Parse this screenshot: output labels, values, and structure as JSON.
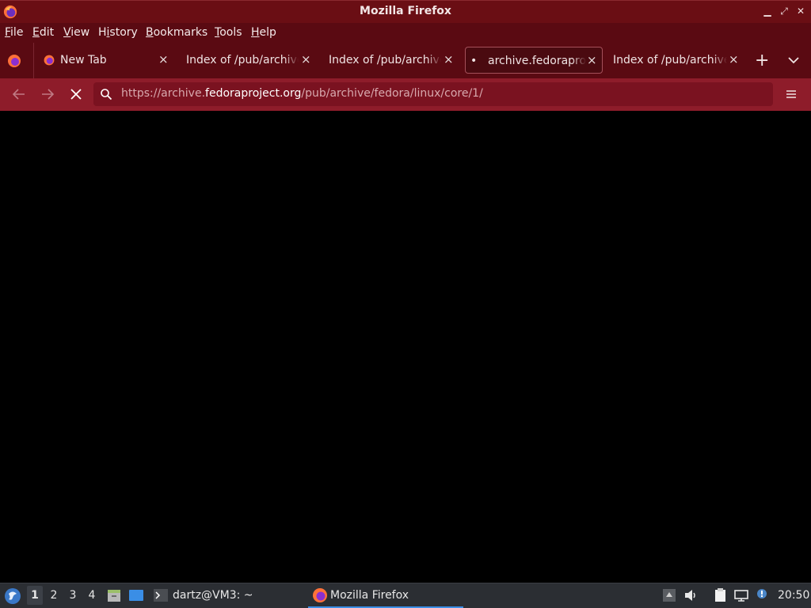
{
  "window": {
    "title": "Mozilla Firefox"
  },
  "menubar": {
    "items": [
      {
        "label": "File"
      },
      {
        "label": "Edit"
      },
      {
        "label": "View"
      },
      {
        "label": "History"
      },
      {
        "label": "Bookmarks"
      },
      {
        "label": "Tools"
      },
      {
        "label": "Help"
      }
    ]
  },
  "tabs": [
    {
      "label": "New Tab",
      "icon": "firefox-icon",
      "active": false
    },
    {
      "label": "Index of /pub/archive/",
      "active": false
    },
    {
      "label": "Index of /pub/archive/",
      "active": false
    },
    {
      "label": "archive.fedoraproject.org",
      "loading_dot": "•",
      "active": true
    },
    {
      "label": "Index of /pub/archive/",
      "active": false
    }
  ],
  "tab_close_glyph": "×",
  "new_tab_glyph": "+",
  "urlbar": {
    "url_prefix": "https://archive.",
    "url_domain": "fedoraproject.org",
    "url_path": "/pub/archive/fedora/linux/core/1/"
  },
  "taskbar": {
    "workspaces": [
      "1",
      "2",
      "3",
      "4"
    ],
    "active_workspace": "1",
    "tasks": [
      {
        "label": "dartz@VM3: ~",
        "icon": "terminal-icon"
      },
      {
        "label": "Mozilla Firefox",
        "icon": "firefox-icon",
        "active": true
      }
    ],
    "clock": "20:50"
  },
  "colors": {
    "titlebar": "#6a0e14",
    "toolbar": "#5a0a12",
    "navbar": "#8e1c2a",
    "content": "#000000",
    "taskbar": "#2b2e33"
  }
}
